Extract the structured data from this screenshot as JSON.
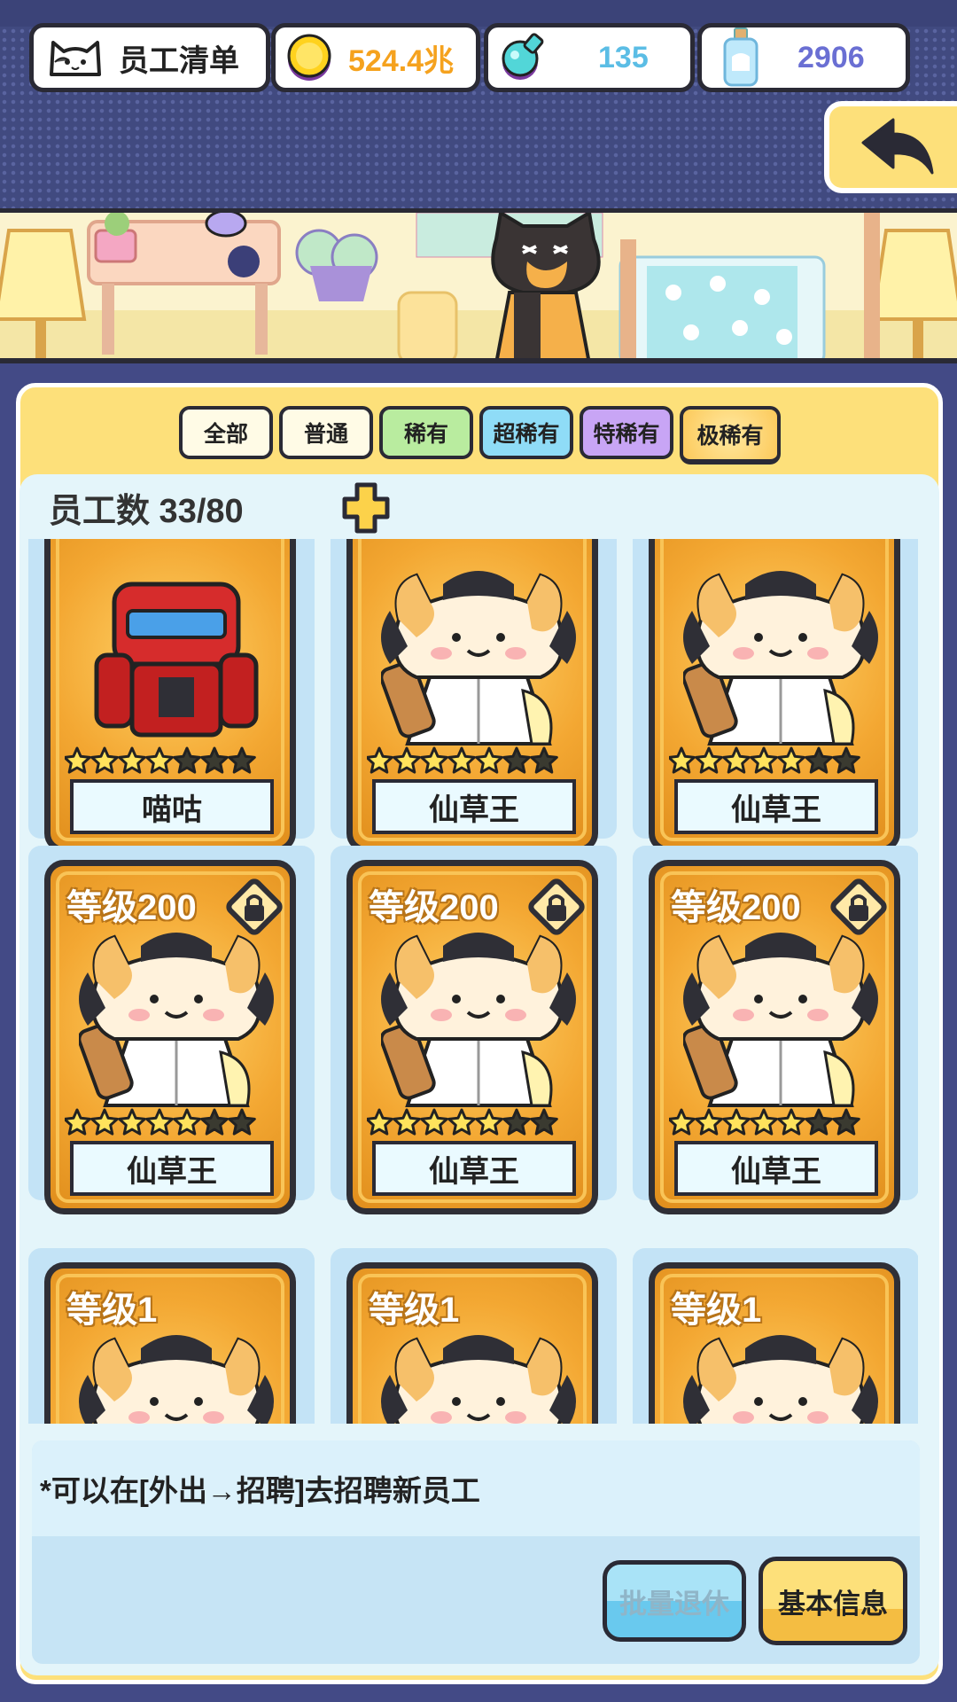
{
  "header": {
    "title": "员工清单",
    "gold": "524.4兆",
    "potion": "135",
    "bottle": "2906",
    "colors": {
      "gold": "#f5a21e",
      "potion": "#5bbde5",
      "bottle": "#6a6fd3"
    }
  },
  "filters": {
    "tabs": [
      {
        "label": "全部",
        "color": "#fffbe6"
      },
      {
        "label": "普通",
        "color": "#fffbe6"
      },
      {
        "label": "稀有",
        "color": "#b9ec9f"
      },
      {
        "label": "超稀有",
        "color": "#8fdcf7"
      },
      {
        "label": "特稀有",
        "color": "#c8a5f5"
      },
      {
        "label": "极稀有",
        "color": "#fcc95a"
      }
    ],
    "selected": "极稀有"
  },
  "staff": {
    "count_label": "员工数 33/80"
  },
  "cards": [
    {
      "name": "喵咕",
      "level": "",
      "stars": 4,
      "max_stars": 7,
      "locked": false,
      "type": "robot"
    },
    {
      "name": "仙草王",
      "level": "",
      "stars": 5,
      "max_stars": 7,
      "locked": false,
      "type": "cat"
    },
    {
      "name": "仙草王",
      "level": "",
      "stars": 5,
      "max_stars": 7,
      "locked": false,
      "type": "cat"
    },
    {
      "name": "仙草王",
      "level": "等级200",
      "stars": 5,
      "max_stars": 7,
      "locked": true,
      "type": "cat"
    },
    {
      "name": "仙草王",
      "level": "等级200",
      "stars": 5,
      "max_stars": 7,
      "locked": true,
      "type": "cat"
    },
    {
      "name": "仙草王",
      "level": "等级200",
      "stars": 5,
      "max_stars": 7,
      "locked": true,
      "type": "cat"
    },
    {
      "name": "",
      "level": "等级1",
      "stars": 0,
      "max_stars": 7,
      "locked": false,
      "type": "cat"
    },
    {
      "name": "",
      "level": "等级1",
      "stars": 0,
      "max_stars": 7,
      "locked": false,
      "type": "cat"
    },
    {
      "name": "",
      "level": "等级1",
      "stars": 0,
      "max_stars": 7,
      "locked": false,
      "type": "cat"
    }
  ],
  "footer": {
    "hint": "*可以在[外出→招聘]去招聘新员工",
    "retire_label": "批量退休",
    "info_label": "基本信息"
  }
}
